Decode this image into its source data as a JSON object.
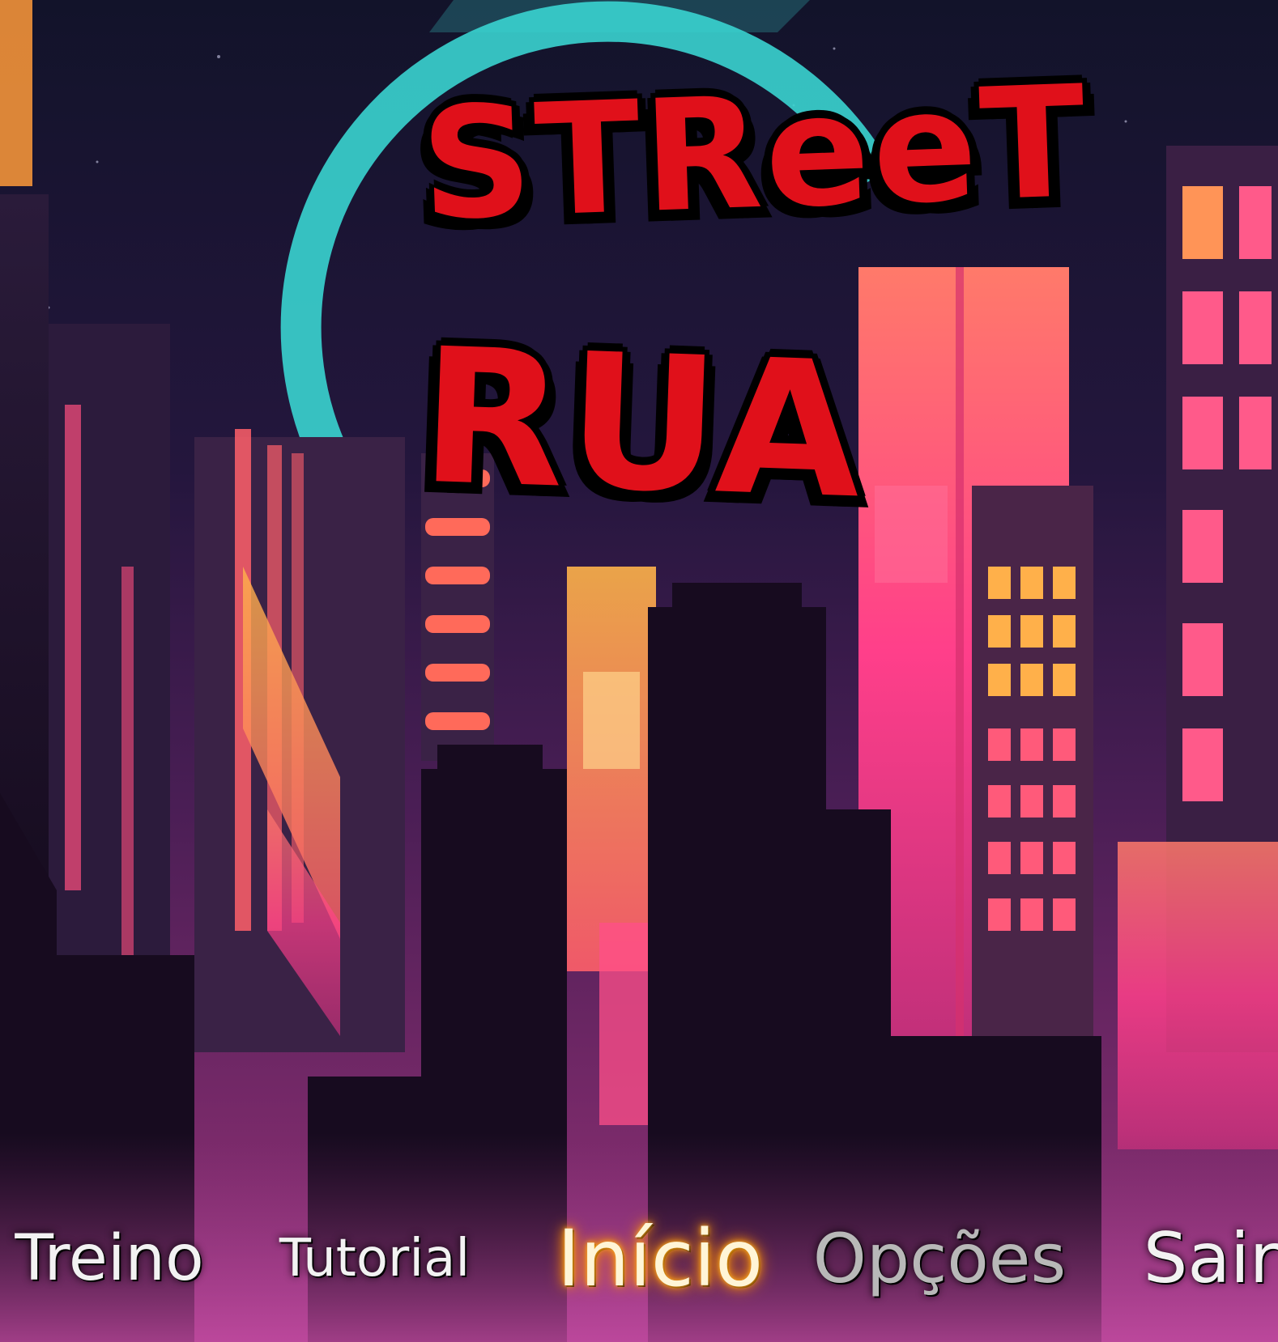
{
  "game": {
    "title_line1": "STReeT",
    "title_line2": "RUA",
    "accent_red": "#e0101a",
    "highlight_orange": "#ff9a00"
  },
  "menu": {
    "items": [
      {
        "id": "treino",
        "label": "Treino",
        "state": "normal"
      },
      {
        "id": "tutorial",
        "label": "Tutorial",
        "state": "normal"
      },
      {
        "id": "inicio",
        "label": "Início",
        "state": "selected"
      },
      {
        "id": "opcoes",
        "label": "Opções",
        "state": "dim"
      },
      {
        "id": "sair",
        "label": "Sair",
        "state": "normal"
      }
    ]
  },
  "background": {
    "theme": "neon-city-skyline",
    "colors": {
      "sky_top": "#12132a",
      "sky_bottom": "#a33e8a",
      "moon_ring": "#3ad4d0",
      "neon_pink": "#ff3f8a",
      "neon_orange": "#ff8a3a",
      "building_dark": "#1b0f22"
    }
  }
}
